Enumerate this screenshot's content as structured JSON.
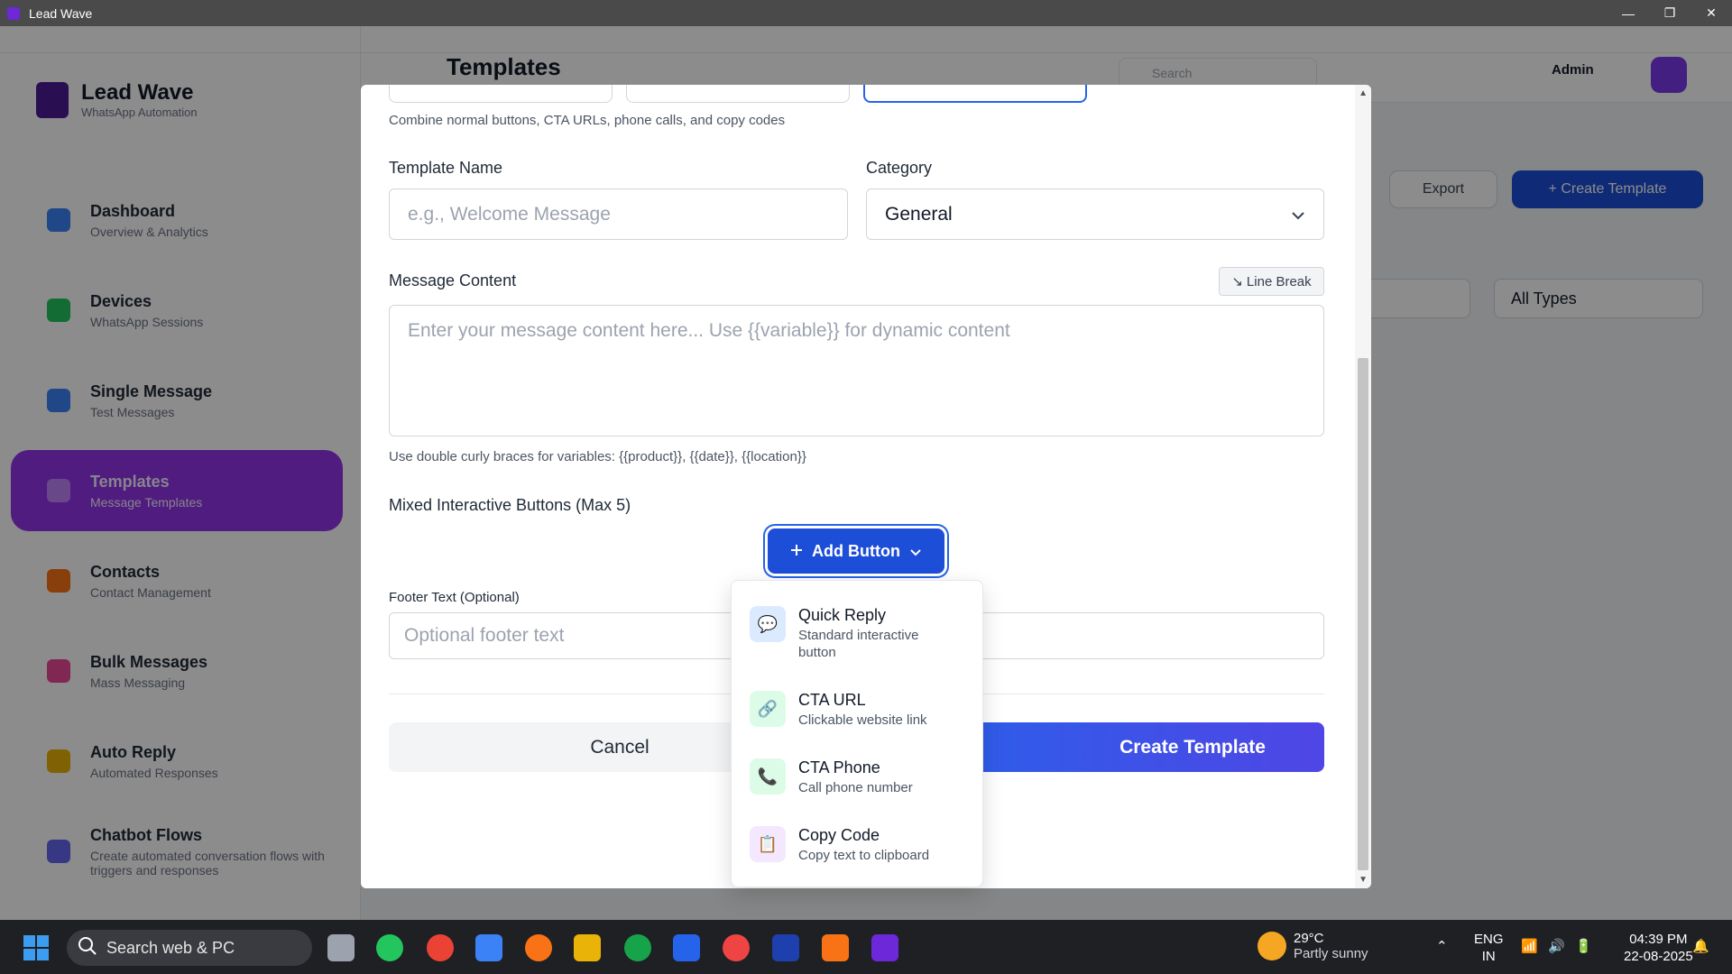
{
  "window": {
    "title": "Lead Wave",
    "minimize": "—",
    "restore": "❐",
    "close": "✕"
  },
  "background": {
    "brand_name": "Lead Wave",
    "brand_sub": "WhatsApp Automation",
    "page_title": "Templates",
    "search_placeholder": "Search",
    "admin_label": "Admin",
    "nav": [
      {
        "label": "Dashboard",
        "sub": "Overview & Analytics",
        "color": "#3b82f6"
      },
      {
        "label": "Devices",
        "sub": "WhatsApp Sessions",
        "color": "#22c55e"
      },
      {
        "label": "Single Message",
        "sub": "Test Messages",
        "color": "#3b82f6"
      },
      {
        "label": "Templates",
        "sub": "Message Templates",
        "color": "#a855f7"
      },
      {
        "label": "Contacts",
        "sub": "Contact Management",
        "color": "#f97316"
      },
      {
        "label": "Bulk Messages",
        "sub": "Mass Messaging",
        "color": "#ec4899"
      },
      {
        "label": "Auto Reply",
        "sub": "Automated Responses",
        "color": "#eab308"
      },
      {
        "label": "Chatbot Flows",
        "sub": "Create automated conversation flows with triggers and responses",
        "color": "#6366f1"
      }
    ],
    "export_label": "Export",
    "create_template_label": "+ Create Template",
    "filter_all_types": "All Types"
  },
  "modal": {
    "buttons_hint": "Combine normal buttons, CTA URLs, phone calls, and copy codes",
    "template_name_label": "Template Name",
    "template_name_placeholder": "e.g., Welcome Message",
    "category_label": "Category",
    "category_value": "General",
    "message_content_label": "Message Content",
    "line_break_label": "Line Break",
    "line_break_icon": "↘",
    "message_placeholder": "Enter your message content here... Use {{variable}} for dynamic content",
    "variables_hint": "Use double curly braces for variables: {{product}}, {{date}}, {{location}}",
    "mixed_buttons_label": "Mixed Interactive Buttons (Max 5)",
    "add_button_label": "Add Button",
    "footer_label": "Footer Text (Optional)",
    "footer_placeholder": "Optional footer text",
    "cancel_label": "Cancel",
    "create_label": "Create Template"
  },
  "dropdown": {
    "items": [
      {
        "label": "Quick Reply",
        "sub": "Standard interactive button",
        "icon": "chat-bubble-icon",
        "glyph": "💬",
        "bg": "#dbeafe"
      },
      {
        "label": "CTA URL",
        "sub": "Clickable website link",
        "icon": "link-icon",
        "glyph": "🔗",
        "bg": "#dcfce7"
      },
      {
        "label": "CTA Phone",
        "sub": "Call phone number",
        "icon": "phone-icon",
        "glyph": "📞",
        "bg": "#dcfce7"
      },
      {
        "label": "Copy Code",
        "sub": "Copy text to clipboard",
        "icon": "clipboard-icon",
        "glyph": "📋",
        "bg": "#f3e8ff"
      }
    ]
  },
  "taskbar": {
    "search_label": "Search web & PC",
    "weather_temp": "29°C",
    "weather_desc": "Partly sunny",
    "lang_top": "ENG",
    "lang_bottom": "IN",
    "time": "04:39 PM",
    "date": "22-08-2025"
  },
  "colors": {
    "primary": "#1d4ed8",
    "accent_purple": "#9333ea"
  }
}
